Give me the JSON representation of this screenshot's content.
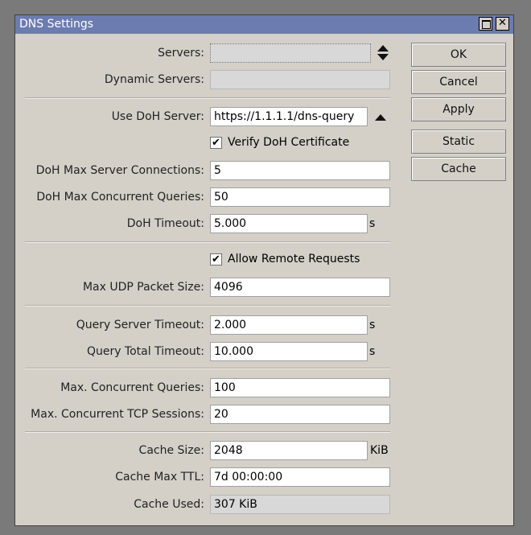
{
  "window": {
    "title": "DNS Settings"
  },
  "titlebar": {
    "close_glyph": "✕"
  },
  "fields": {
    "servers": {
      "label": "Servers:",
      "value": ""
    },
    "dynamic_servers": {
      "label": "Dynamic Servers:",
      "value": ""
    },
    "use_doh_server": {
      "label": "Use DoH Server:",
      "value": "https://1.1.1.1/dns-query"
    },
    "verify_doh_certificate": {
      "label": "Verify DoH Certificate",
      "checked": true
    },
    "doh_max_server_connections": {
      "label": "DoH Max Server Connections:",
      "value": "5"
    },
    "doh_max_concurrent_queries": {
      "label": "DoH Max Concurrent Queries:",
      "value": "50"
    },
    "doh_timeout": {
      "label": "DoH Timeout:",
      "value": "5.000",
      "unit": "s"
    },
    "allow_remote_requests": {
      "label": "Allow Remote Requests",
      "checked": true
    },
    "max_udp_packet_size": {
      "label": "Max UDP Packet Size:",
      "value": "4096"
    },
    "query_server_timeout": {
      "label": "Query Server Timeout:",
      "value": "2.000",
      "unit": "s"
    },
    "query_total_timeout": {
      "label": "Query Total Timeout:",
      "value": "10.000",
      "unit": "s"
    },
    "max_concurrent_queries": {
      "label": "Max. Concurrent Queries:",
      "value": "100"
    },
    "max_concurrent_tcp_sessions": {
      "label": "Max. Concurrent TCP Sessions:",
      "value": "20"
    },
    "cache_size": {
      "label": "Cache Size:",
      "value": "2048",
      "unit": "KiB"
    },
    "cache_max_ttl": {
      "label": "Cache Max TTL:",
      "value": "7d 00:00:00"
    },
    "cache_used": {
      "label": "Cache Used:",
      "value": "307 KiB"
    }
  },
  "checkbox_glyph": "✔",
  "buttons": {
    "ok": "OK",
    "cancel": "Cancel",
    "apply": "Apply",
    "static": "Static",
    "cache": "Cache"
  },
  "colors": {
    "titlebar": "#6c7cb0",
    "window_bg": "#d4d0c8",
    "desktop": "#7a7a7a"
  },
  "icons": {
    "maximize": "maximize-icon",
    "close": "close-icon",
    "spinner": "up-down-arrows-icon",
    "collapse": "triangle-up-icon",
    "check": "checkmark-icon"
  }
}
